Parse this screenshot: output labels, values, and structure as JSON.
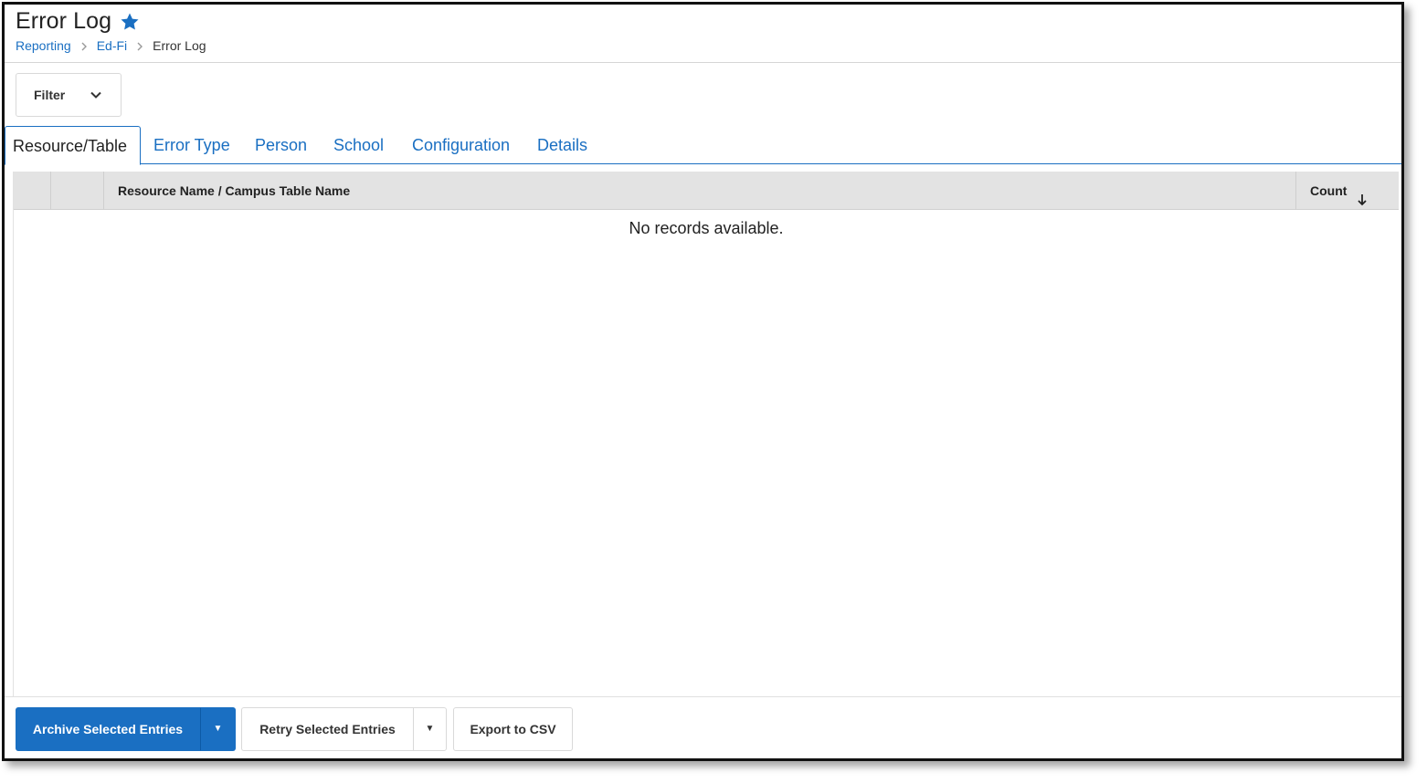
{
  "header": {
    "title": "Error Log",
    "breadcrumb": [
      {
        "label": "Reporting"
      },
      {
        "label": "Ed-Fi"
      },
      {
        "label": "Error Log"
      }
    ]
  },
  "filter": {
    "label": "Filter"
  },
  "tabs": [
    {
      "label": "Resource/Table",
      "active": true
    },
    {
      "label": "Error Type"
    },
    {
      "label": "Person"
    },
    {
      "label": "School"
    },
    {
      "label": "Configuration"
    },
    {
      "label": "Details"
    }
  ],
  "grid": {
    "columns": [
      "",
      "",
      "Resource Name / Campus Table Name",
      "Count"
    ],
    "sort": {
      "column": "Count",
      "direction": "descending"
    },
    "empty_message": "No records available.",
    "rows": []
  },
  "footer": {
    "archive_label": "Archive Selected Entries",
    "retry_label": "Retry Selected Entries",
    "export_label": "Export to CSV",
    "caret": "▼"
  },
  "icons": {
    "favorite": "star-icon",
    "breadcrumb_separator": "chevron-right-icon",
    "filter_toggle": "chevron-down-icon",
    "sort": "arrow-down-icon"
  },
  "colors": {
    "accent": "#1a6fc2",
    "header_bg": "#e3e3e3",
    "text": "#222222"
  }
}
